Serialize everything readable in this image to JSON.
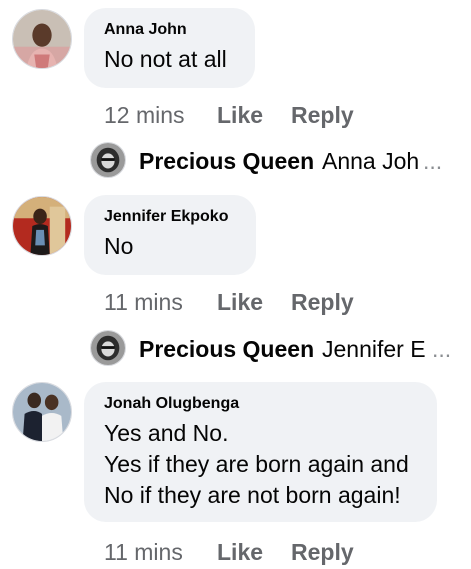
{
  "comments": [
    {
      "author": "Anna John",
      "text": "No not at all",
      "time": "12 mins",
      "like": "Like",
      "reply": "Reply"
    },
    {
      "author": "Jennifer Ekpoko",
      "text": "No",
      "time": "11 mins",
      "like": "Like",
      "reply": "Reply"
    },
    {
      "author": "Jonah Olugbenga",
      "text_lines": [
        "Yes and No.",
        "Yes if they are born again and",
        "No if they are not born again!"
      ],
      "time": "11 mins",
      "like": "Like",
      "reply": "Reply"
    }
  ],
  "replies": [
    {
      "author": "Precious Queen",
      "preview": "Anna Joh",
      "ellipsis": "..."
    },
    {
      "author": "Precious Queen",
      "preview": "Jennifer E",
      "ellipsis": "..."
    }
  ],
  "colors": {
    "bubble": "#f0f2f5",
    "meta": "#65676b",
    "text": "#050505"
  }
}
